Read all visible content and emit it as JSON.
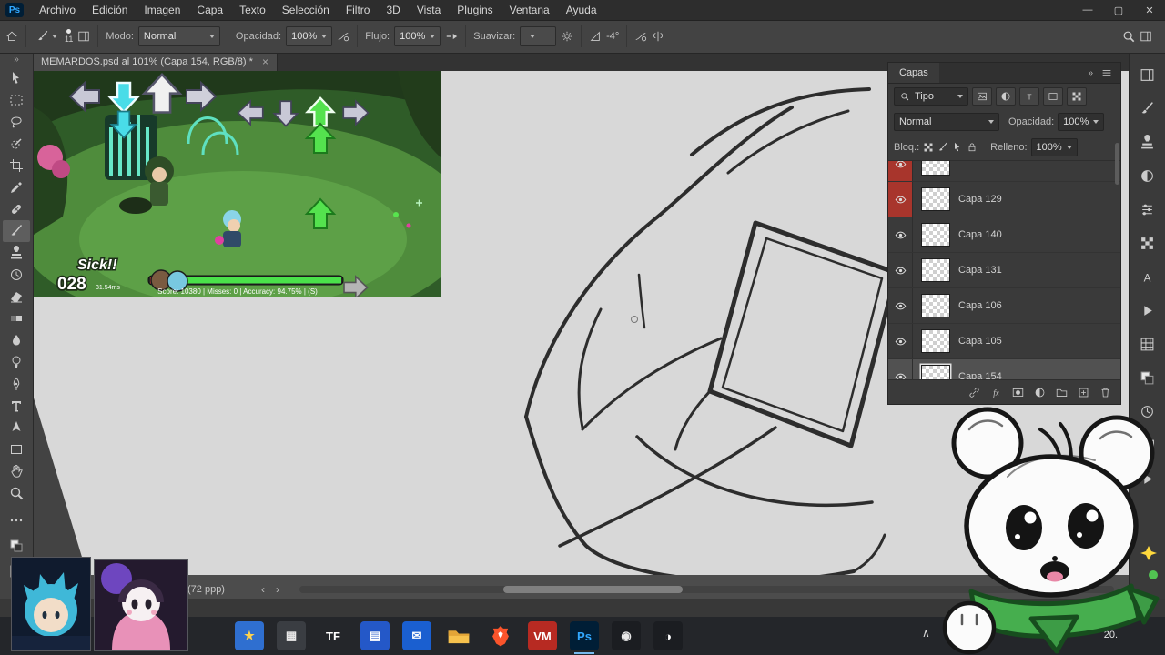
{
  "app": {
    "logo": "Ps"
  },
  "menu": {
    "items": [
      "Archivo",
      "Edición",
      "Imagen",
      "Capa",
      "Texto",
      "Selección",
      "Filtro",
      "3D",
      "Vista",
      "Plugins",
      "Ventana",
      "Ayuda"
    ]
  },
  "window_controls": {
    "minimize": "—",
    "restore": "▢",
    "close": "✕"
  },
  "options_bar": {
    "brush_size": "11",
    "mode_label": "Modo:",
    "mode_value": "Normal",
    "opacity_label": "Opacidad:",
    "opacity_value": "100%",
    "flow_label": "Flujo:",
    "flow_value": "100%",
    "smooth_label": "Suavizar:",
    "smooth_value": "",
    "angle_value": "-4°"
  },
  "toolbar": {
    "collapse_glyph": "»",
    "tools": [
      {
        "name": "move",
        "icon": "move"
      },
      {
        "name": "marquee",
        "icon": "marquee"
      },
      {
        "name": "lasso",
        "icon": "lasso"
      },
      {
        "name": "quick-select",
        "icon": "quickselect"
      },
      {
        "name": "crop",
        "icon": "crop"
      },
      {
        "name": "eyedropper",
        "icon": "eyedropper"
      },
      {
        "name": "healing",
        "icon": "healing"
      },
      {
        "name": "brush",
        "icon": "brush",
        "active": true
      },
      {
        "name": "clone-stamp",
        "icon": "stamp"
      },
      {
        "name": "history-brush",
        "icon": "history"
      },
      {
        "name": "eraser",
        "icon": "eraser"
      },
      {
        "name": "gradient",
        "icon": "gradient"
      },
      {
        "name": "blur",
        "icon": "blur"
      },
      {
        "name": "dodge",
        "icon": "dodge"
      },
      {
        "name": "pen",
        "icon": "pen"
      },
      {
        "name": "type",
        "icon": "type"
      },
      {
        "name": "path-select",
        "icon": "pathselect"
      },
      {
        "name": "shape",
        "icon": "shape"
      },
      {
        "name": "hand",
        "icon": "hand"
      },
      {
        "name": "zoom",
        "icon": "zoom"
      }
    ],
    "extras": [
      {
        "name": "toolbar-options",
        "icon": "ellipsis"
      },
      {
        "name": "color-swatches",
        "icon": "swatches"
      },
      {
        "name": "quick-mask",
        "icon": "quickmask"
      },
      {
        "name": "screen-mode",
        "icon": "screenmode"
      }
    ]
  },
  "doc_tab": {
    "title": "MEMARDOS.psd al 101% (Capa 154, RGB/8) *",
    "close_glyph": "×"
  },
  "layers_panel": {
    "title": "Capas",
    "collapse_glyph": "»",
    "filter_value": "Tipo",
    "blend_value": "Normal",
    "opacity_label": "Opacidad:",
    "opacity_value": "100%",
    "lock_label": "Bloq.:",
    "fill_label": "Relleno:",
    "fill_value": "100%",
    "layers": [
      {
        "name": "",
        "partial": true,
        "color": "#a8352c"
      },
      {
        "name": "Capa 129",
        "color": "#a8352c"
      },
      {
        "name": "Capa 140"
      },
      {
        "name": "Capa 131"
      },
      {
        "name": "Capa 106"
      },
      {
        "name": "Capa 105"
      },
      {
        "name": "Capa 154",
        "selected": true
      }
    ]
  },
  "right_strip": {
    "icons": [
      {
        "name": "libraries-panel-icon",
        "icon": "panels"
      },
      {
        "name": "brushes-panel-icon",
        "icon": "brush"
      },
      {
        "name": "clone-source-panel-icon",
        "icon": "stamp"
      },
      {
        "name": "adjustments-panel-icon",
        "icon": "adjust"
      },
      {
        "name": "properties-panel-icon",
        "icon": "sliders"
      },
      {
        "name": "patterns-panel-icon",
        "icon": "checker"
      },
      {
        "name": "character-panel-icon",
        "icon": "charA"
      },
      {
        "name": "actions-panel-icon",
        "icon": "play"
      },
      {
        "name": "info-panel-icon",
        "icon": "grid"
      },
      {
        "name": "color-panel-icon",
        "icon": "swatches"
      },
      {
        "name": "history-panel-icon",
        "icon": "history"
      },
      {
        "name": "navigator-panel-icon",
        "icon": "mask"
      },
      {
        "name": "timeline-panel-icon",
        "icon": "play"
      }
    ]
  },
  "status_bar": {
    "doc_info": "(72 ppp)",
    "nav_left": "‹",
    "nav_right": "›"
  },
  "game_capture": {
    "combo_label": "Sick!!",
    "combo_count": "028",
    "combo_ms": "31.54ms",
    "score_line": "Score: 10380 | Misses: 0 | Accuracy: 94.75% | (S)"
  },
  "taskbar": {
    "clock": "20.",
    "tray_chevron": "∧",
    "icons": [
      {
        "name": "game-app-icon",
        "bg": "#2f6fd0",
        "glyph": "★",
        "fg": "#ffd34d"
      },
      {
        "name": "blocks-app-icon",
        "bg": "#3a3d42",
        "glyph": "▦",
        "fg": "#e8e8e8"
      },
      {
        "name": "tf-app-icon",
        "bg": "",
        "glyph": "TF",
        "fg": "#ffffff"
      },
      {
        "name": "grid-app-icon",
        "bg": "#2458c8",
        "glyph": "▤",
        "fg": "#ffffff"
      },
      {
        "name": "mail-app-icon",
        "bg": "#1a5fd0",
        "glyph": "✉",
        "fg": "#ffffff"
      },
      {
        "name": "file-explorer-icon",
        "icon": "folderc"
      },
      {
        "name": "brave-browser-icon",
        "icon": "brave"
      },
      {
        "name": "voicemeeter-icon",
        "bg": "#b72a22",
        "glyph": "VM",
        "fg": "#ffffff"
      },
      {
        "name": "photoshop-icon",
        "bg": "#001e36",
        "glyph": "Ps",
        "fg": "#31a8ff",
        "active": true
      },
      {
        "name": "dark-app-icon",
        "bg": "#1b1d21",
        "glyph": "◉",
        "fg": "#e8e8e8"
      },
      {
        "name": "obs-icon",
        "bg": "#1b1d21",
        "glyph": "◑",
        "fg": "#ffffff"
      }
    ]
  },
  "colors": {
    "ps_blue": "#31a8ff",
    "layer_color_red": "#a8352c",
    "note_cyan": "#49dce8",
    "note_green": "#54e24e",
    "bandana_green": "#46ae4e"
  }
}
